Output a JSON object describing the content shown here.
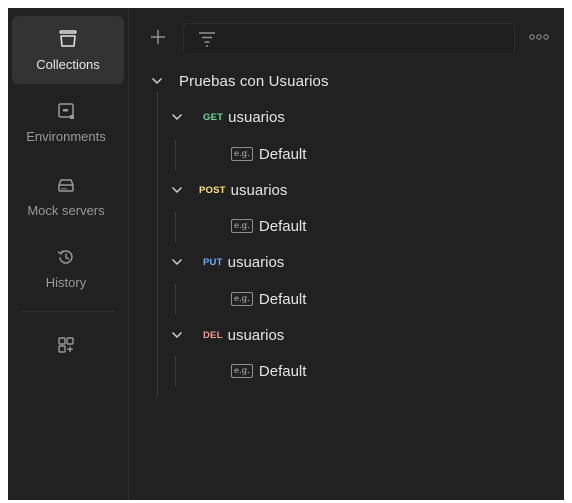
{
  "sidebar": {
    "items": [
      {
        "label": "Collections",
        "icon": "collections-icon",
        "active": true
      },
      {
        "label": "Environments",
        "icon": "environments-icon",
        "active": false
      },
      {
        "label": "Mock servers",
        "icon": "mock-servers-icon",
        "active": false
      },
      {
        "label": "History",
        "icon": "history-icon",
        "active": false
      }
    ],
    "extra_icon": "add-workbench-icon"
  },
  "toolbar": {
    "add_icon": "plus-icon",
    "filter_icon": "filter-icon",
    "more_icon": "more-options-icon"
  },
  "collection": {
    "name": "Pruebas con Usuarios",
    "requests": [
      {
        "method": "GET",
        "name": "usuarios",
        "example": "Default",
        "example_badge": "e.g."
      },
      {
        "method": "POST",
        "name": "usuarios",
        "example": "Default",
        "example_badge": "e.g."
      },
      {
        "method": "PUT",
        "name": "usuarios",
        "example": "Default",
        "example_badge": "e.g."
      },
      {
        "method": "DEL",
        "name": "usuarios",
        "example": "Default",
        "example_badge": "e.g."
      }
    ]
  },
  "colors": {
    "background": "#212121",
    "active_item": "#333333",
    "get": "#6bdd9a",
    "post": "#ffe47e",
    "put": "#74aef6",
    "del": "#f79a8e"
  }
}
